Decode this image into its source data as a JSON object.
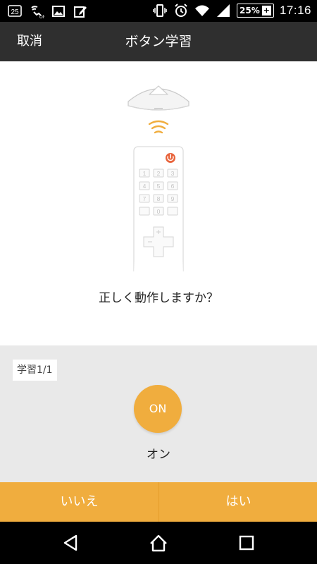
{
  "status_bar": {
    "notification_badge": "25",
    "battery_percent": "25%",
    "battery_charging": "+",
    "time": "17:16",
    "icons": [
      "notification-badge-icon",
      "wifi-call-icon",
      "image-icon",
      "edit-icon",
      "vibrate-icon",
      "alarm-icon",
      "wifi-icon",
      "signal-icon",
      "battery-icon"
    ]
  },
  "header": {
    "cancel_label": "取消",
    "title": "ボタン学習"
  },
  "illustration": {
    "remote_keys": [
      "1",
      "2",
      "3",
      "4",
      "5",
      "6",
      "7",
      "8",
      "9",
      "0"
    ],
    "power_color": "#e8633b",
    "signal_color": "#f0ad3e"
  },
  "prompt": {
    "question": "正しく動作しますか？"
  },
  "panel": {
    "step_tag": "学習1/1",
    "button_text": "ON",
    "button_label": "オン"
  },
  "actions": {
    "no_label": "いいえ",
    "yes_label": "はい",
    "accent_color": "#f0ad3e"
  }
}
